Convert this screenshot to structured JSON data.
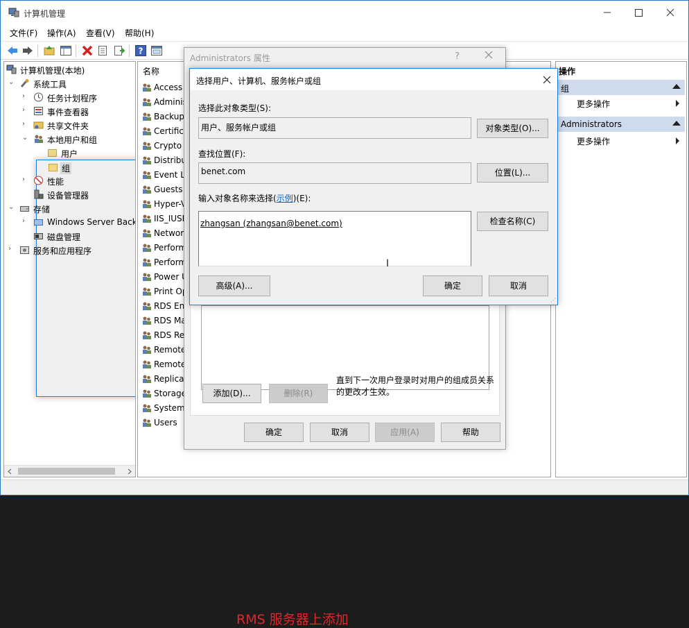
{
  "window": {
    "title": "计算机管理",
    "controls": [
      "minimize",
      "maximize",
      "close"
    ]
  },
  "menu": [
    "文件(F)",
    "操作(A)",
    "查看(V)",
    "帮助(H)"
  ],
  "tree": {
    "root": "计算机管理(本地)",
    "nodes": [
      {
        "label": "系统工具"
      },
      {
        "label": "任务计划程序"
      },
      {
        "label": "事件查看器"
      },
      {
        "label": "共享文件夹"
      },
      {
        "label": "本地用户和组"
      },
      {
        "label": "用户"
      },
      {
        "label": "组"
      },
      {
        "label": "性能"
      },
      {
        "label": "设备管理器"
      },
      {
        "label": "存储"
      },
      {
        "label": "Windows Server Back"
      },
      {
        "label": "磁盘管理"
      },
      {
        "label": "服务和应用程序"
      }
    ]
  },
  "list": {
    "column_header": "名称",
    "items": [
      "Access",
      "Adminis",
      "Backup",
      "Certifica",
      "Crypto",
      "Distribu",
      "Event Lo",
      "Guests",
      "Hyper-V",
      "IIS_IUSR",
      "Networ",
      "Perform",
      "Perform",
      "Power U",
      "Print Op",
      "RDS End",
      "RDS Ma",
      "RDS Re",
      "Remote",
      "Remote",
      "Replicat",
      "Storage",
      "System",
      "Users"
    ]
  },
  "actions": {
    "title": "操作",
    "groups": [
      {
        "label": "组",
        "item": "更多操作"
      },
      {
        "label": "Administrators",
        "item": "更多操作"
      }
    ]
  },
  "props_dialog": {
    "title": "Administrators 属性",
    "help": "?",
    "annotation": "RMS 服务器上添加",
    "add_button": "添加(D)...",
    "remove_button": "删除(R)",
    "note": "直到下一次用户登录时对用户的组成员关系的更改才生效。",
    "ok": "确定",
    "cancel": "取消",
    "apply": "应用(A)",
    "help_button": "帮助"
  },
  "select_dialog": {
    "title": "选择用户、计算机、服务帐户或组",
    "object_type_label": "选择此对象类型(S):",
    "object_type_value": "用户、服务帐户或组",
    "object_type_button": "对象类型(O)...",
    "location_label": "查找位置(F):",
    "location_value": "benet.com",
    "location_button": "位置(L)...",
    "enter_label_prefix": "输入对象名称来选择(",
    "enter_label_link": "示例",
    "enter_label_suffix": ")(E):",
    "entered_value": "zhangsan (zhangsan@benet.com)",
    "check_button": "检查名称(C)",
    "advanced_button": "高级(A)...",
    "ok": "确定",
    "cancel": "取消"
  }
}
